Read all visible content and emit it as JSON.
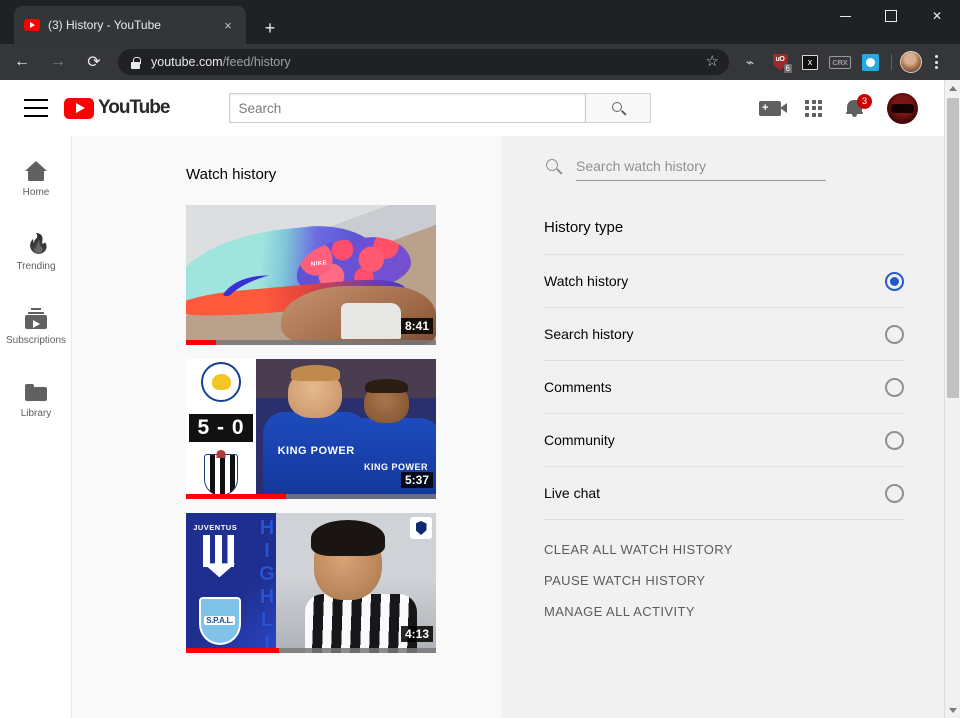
{
  "browser": {
    "tab": {
      "title": "(3) History - YouTube",
      "favicon": "youtube-icon",
      "close": "×"
    },
    "new_tab_label": "+",
    "window_controls": {
      "minimize": "minimize-icon",
      "maximize": "maximize-icon",
      "close": "✕"
    },
    "nav": {
      "back": "←",
      "forward": "→",
      "reload": "⟳"
    },
    "omnibox": {
      "lock": "lock-icon",
      "url_domain": "youtube.com",
      "url_path": "/feed/history",
      "bookmark": "☆"
    },
    "extensions": [
      {
        "name": "share-icon",
        "label": "⌁"
      },
      {
        "name": "ublock-origin-icon",
        "label": "uO",
        "badge": "6"
      },
      {
        "name": "window-close-extension-icon",
        "label": "x"
      },
      {
        "name": "crx-extension-icon",
        "label": "CRX"
      },
      {
        "name": "blue-media-extension-icon",
        "label": ""
      }
    ],
    "profile_avatar": "chrome-profile-avatar",
    "menu": "three-dot-menu-icon"
  },
  "youtube": {
    "header": {
      "menu_icon": "hamburger-menu-icon",
      "logo_text": "YouTube",
      "search": {
        "placeholder": "Search",
        "button_icon": "search-icon"
      },
      "create_icon": "video-camera-plus-icon",
      "apps_icon": "apps-grid-icon",
      "notifications": {
        "icon": "bell-icon",
        "badge": "3"
      },
      "avatar": "channel-avatar"
    },
    "sidebar": {
      "items": [
        {
          "label": "Home",
          "icon": "home-icon"
        },
        {
          "label": "Trending",
          "icon": "flame-icon"
        },
        {
          "label": "Subscriptions",
          "icon": "subscriptions-icon"
        },
        {
          "label": "Library",
          "icon": "library-folder-icon"
        }
      ]
    },
    "main": {
      "title": "Watch history",
      "videos": [
        {
          "thumbnail_desc": "nike-sneaker-thumbnail",
          "duration": "8:41",
          "progress_percent": 12,
          "overlay_text": "NIKE"
        },
        {
          "thumbnail_desc": "leicester-newcastle-thumbnail",
          "duration": "5:37",
          "progress_percent": 40,
          "score": "5 - 0",
          "kit_text_1": "KING POWER",
          "kit_text_2": "KING POWER"
        },
        {
          "thumbnail_desc": "juventus-spal-ronaldo-thumbnail",
          "duration": "4:13",
          "progress_percent": 37,
          "team_a": "JUVENTUS",
          "team_b": "S.P.A.L.",
          "banner_text": "HIGHLIGHT"
        }
      ]
    },
    "right_panel": {
      "search": {
        "placeholder": "Search watch history",
        "icon": "search-icon"
      },
      "section_title": "History type",
      "options": [
        {
          "label": "Watch history",
          "selected": true
        },
        {
          "label": "Search history",
          "selected": false
        },
        {
          "label": "Comments",
          "selected": false
        },
        {
          "label": "Community",
          "selected": false
        },
        {
          "label": "Live chat",
          "selected": false
        }
      ],
      "actions": [
        "CLEAR ALL WATCH HISTORY",
        "PAUSE WATCH HISTORY",
        "MANAGE ALL ACTIVITY"
      ]
    }
  },
  "scrollbar": {
    "up": "scroll-up-arrow",
    "down": "scroll-down-arrow"
  },
  "colors": {
    "youtube_red": "#ff0000",
    "radio_selected": "#2559c9",
    "badge_red": "#cc0000",
    "chrome_dark": "#202124",
    "panel_bg": "#f1f1f1"
  }
}
